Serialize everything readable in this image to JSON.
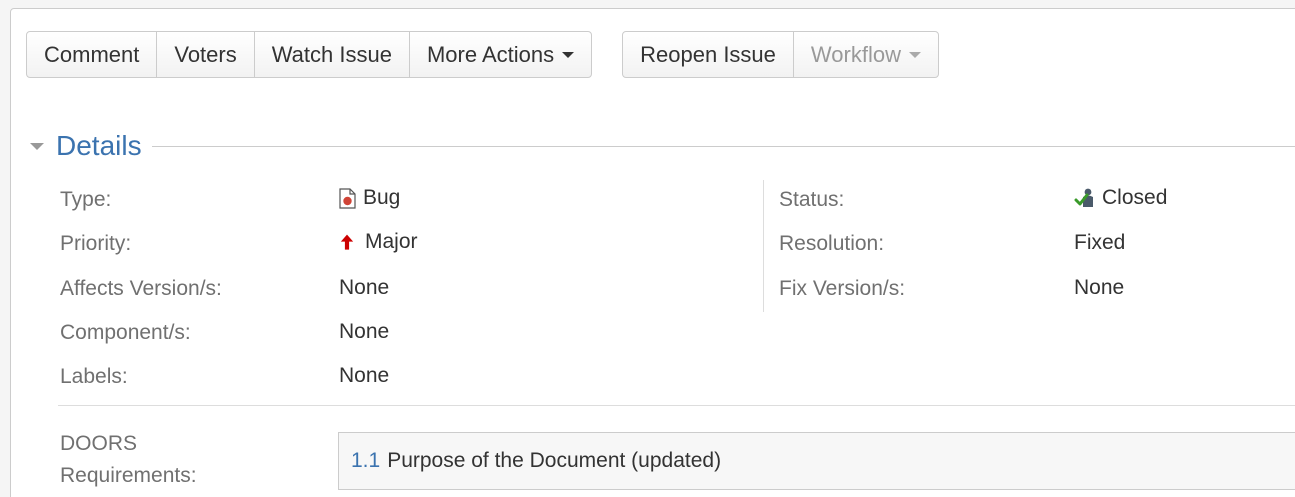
{
  "toolbar": {
    "group1": [
      {
        "label": "Comment"
      },
      {
        "label": "Voters"
      },
      {
        "label": "Watch Issue"
      },
      {
        "label": "More Actions"
      }
    ],
    "group2": [
      {
        "label": "Reopen Issue"
      },
      {
        "label": "Workflow"
      }
    ]
  },
  "details": {
    "title": "Details",
    "left": [
      {
        "label": "Type:",
        "value": "Bug",
        "icon": "bug-icon"
      },
      {
        "label": "Priority:",
        "value": "Major",
        "icon": "major-priority-icon"
      },
      {
        "label": "Affects Version/s:",
        "value": "None"
      },
      {
        "label": "Component/s:",
        "value": "None"
      },
      {
        "label": "Labels:",
        "value": "None"
      }
    ],
    "right": [
      {
        "label": "Status:",
        "value": "Closed",
        "icon": "closed-status-icon"
      },
      {
        "label": "Resolution:",
        "value": "Fixed"
      },
      {
        "label": "Fix Version/s:",
        "value": "None"
      }
    ]
  },
  "doors": {
    "label_line1": "DOORS",
    "label_line2": "Requirements:",
    "number": "1.1",
    "text": "Purpose of the Document (updated)"
  },
  "colors": {
    "accent": "#3b73af",
    "label": "#707070",
    "text": "#333333",
    "bug_red": "#d04437"
  }
}
